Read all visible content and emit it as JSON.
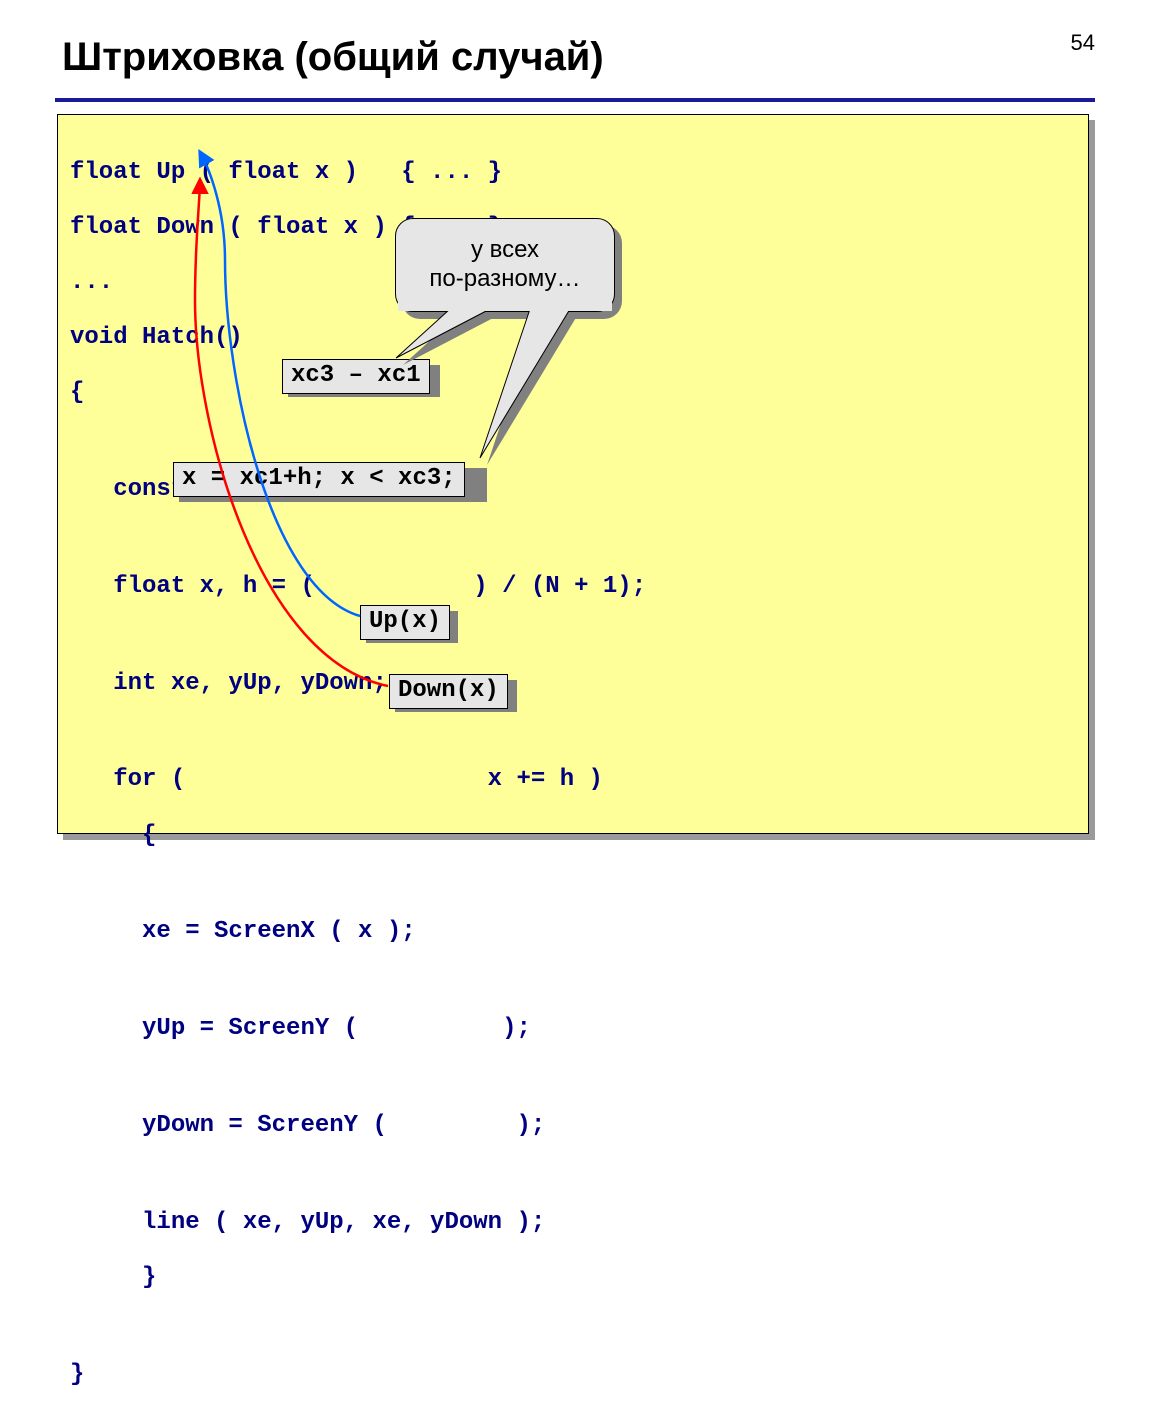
{
  "pageNumber": "54",
  "title": "Штриховка (общий случай)",
  "code": {
    "l1": "float Up ( float x )   { ... }",
    "l2": "float Down ( float x ) { ... }",
    "l3": "...",
    "l4": "void Hatch()",
    "l5": "{",
    "l6": "   const N = 10;",
    "l7": "   float x, h = (           ) / (N + 1);",
    "l8": "   int xe, yUp, yDown;",
    "l9a": "   for ( ",
    "l9b": " x += h )",
    "l10": "     {",
    "l11": "     xe = ScreenX ( x );",
    "l12": "     yUp = ScreenY ( ",
    "l12b": "   );",
    "l13": "     yDown = ScreenY ( ",
    "l13b": " );",
    "l14": "     line ( xe, yUp, xe, yDown );",
    "l15": "     }",
    "l16": "}"
  },
  "chips": {
    "xc": "xc3 – xc1",
    "forCond": "x = xc1+h; x < xc3;",
    "up": "Up(x)",
    "down": "Down(x)"
  },
  "bubble": "у всех\nпо-разному…"
}
